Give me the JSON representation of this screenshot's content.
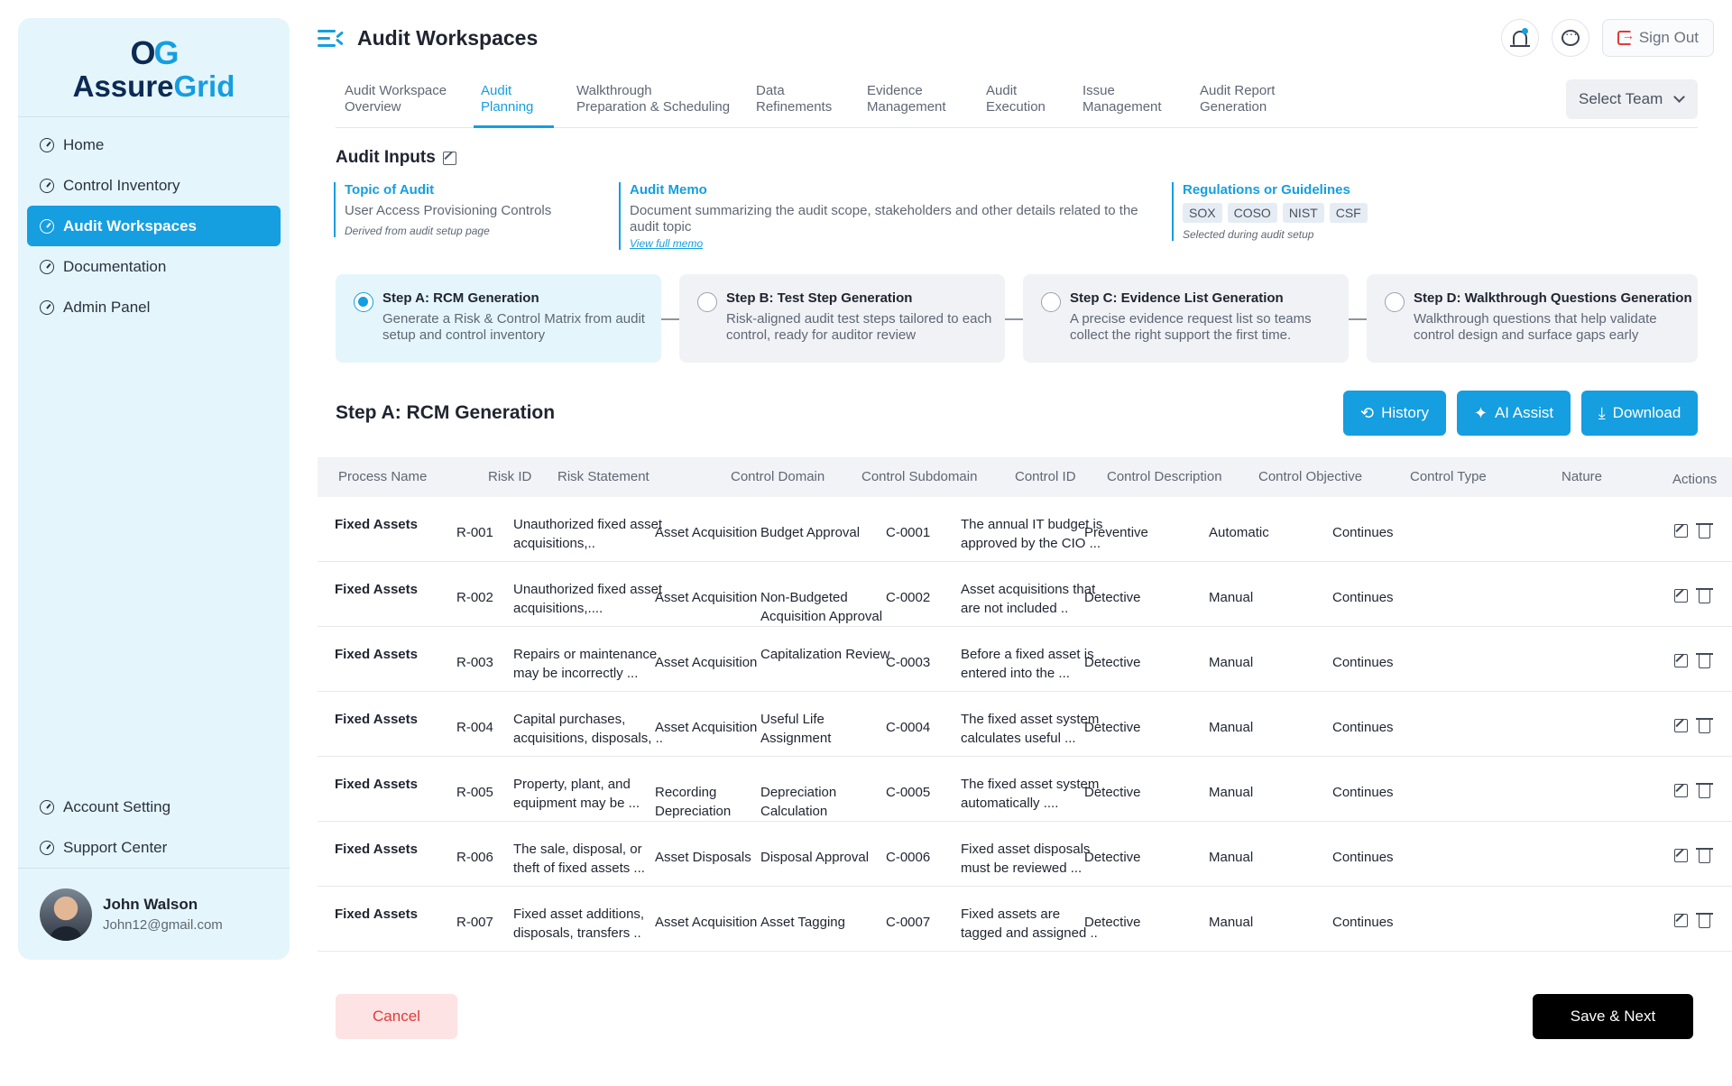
{
  "brand": {
    "logo_mark_left": "O",
    "logo_mark_right": "G",
    "name_part1": "Assure",
    "name_part2": "Grid"
  },
  "sidebar": {
    "items": [
      {
        "label": "Home",
        "icon": "gauge-icon",
        "active": false
      },
      {
        "label": "Control Inventory",
        "icon": "gauge-icon",
        "active": false
      },
      {
        "label": "Audit Workspaces",
        "icon": "gauge-icon",
        "active": true
      },
      {
        "label": "Documentation",
        "icon": "gauge-icon",
        "active": false
      },
      {
        "label": "Admin Panel",
        "icon": "gauge-icon",
        "active": false
      }
    ],
    "bottom_items": [
      {
        "label": "Account Setting",
        "icon": "gauge-icon"
      },
      {
        "label": "Support Center",
        "icon": "gauge-icon"
      }
    ],
    "user": {
      "name": "John Walson",
      "email": "John12@gmail.com"
    }
  },
  "header": {
    "title": "Audit Workspaces",
    "signout_label": "Sign Out"
  },
  "tabs": {
    "items": [
      {
        "label": "Audit Workspace\nOverview",
        "active": false
      },
      {
        "label": "Audit\nPlanning",
        "active": true
      },
      {
        "label": "Walkthrough\nPreparation & Scheduling",
        "active": false
      },
      {
        "label": "Data\nRefinements",
        "active": false
      },
      {
        "label": "Evidence\nManagement",
        "active": false
      },
      {
        "label": "Audit\nExecution",
        "active": false
      },
      {
        "label": "Issue\nManagement",
        "active": false
      },
      {
        "label": "Audit Report\nGeneration",
        "active": false
      }
    ],
    "team_select": "Select Team"
  },
  "audit_inputs": {
    "title": "Audit Inputs",
    "topic": {
      "label": "Topic of Audit",
      "value": "User Access Provisioning Controls",
      "note": "Derived from audit setup page"
    },
    "memo": {
      "label": "Audit Memo",
      "value": "Document summarizing the audit scope, stakeholders and other details related to the audit topic",
      "link": "View full memo"
    },
    "regulations": {
      "label": "Regulations or Guidelines",
      "chips": [
        "SOX",
        "COSO",
        "NIST",
        "CSF"
      ],
      "note": "Selected during audit setup"
    }
  },
  "steps": [
    {
      "title": "Step A: RCM Generation",
      "desc": "Generate a Risk & Control Matrix from audit setup and control inventory",
      "selected": true
    },
    {
      "title": "Step B: Test Step Generation",
      "desc": "Risk-aligned audit test steps tailored to each control, ready for auditor review",
      "selected": false
    },
    {
      "title": "Step C: Evidence List Generation",
      "desc": "A precise evidence request list so teams collect the right support the first time.",
      "selected": false
    },
    {
      "title": "Step D: Walkthrough Questions Generation",
      "desc": "Walkthrough questions that help validate control design and surface gaps early",
      "selected": false
    }
  ],
  "section": {
    "title": "Step A: RCM Generation",
    "history_label": "History",
    "ai_assist_label": "AI Assist",
    "download_label": "Download"
  },
  "table": {
    "headers": [
      "Process Name",
      "Risk ID",
      "Risk Statement",
      "Control Domain",
      "Control Subdomain",
      "Control ID",
      "Control Description",
      "Control Objective",
      "Control Type",
      "Nature",
      "Actions"
    ],
    "rows": [
      {
        "process": "Fixed Assets",
        "risk_id": "R-001",
        "risk_statement": "Unauthorized fixed asset acquisitions,..",
        "domain": "Asset Acquisition",
        "subdomain": "Budget Approval",
        "control_id": "C-0001",
        "description": "The annual IT budget is approved by the CIO ...",
        "objective": "Preventive",
        "type": "Automatic",
        "nature": "Continues"
      },
      {
        "process": "Fixed Assets",
        "risk_id": "R-002",
        "risk_statement": "Unauthorized fixed asset acquisitions,....",
        "domain": "Asset Acquisition",
        "subdomain": "Non-Budgeted Acquisition Approval",
        "control_id": "C-0002",
        "description": "Asset acquisitions that are not included ..",
        "objective": "Detective",
        "type": "Manual",
        "nature": "Continues"
      },
      {
        "process": "Fixed Assets",
        "risk_id": "R-003",
        "risk_statement": "Repairs or maintenance may be incorrectly ...",
        "domain": "Asset Acquisition",
        "subdomain": "Capitalization Review",
        "control_id": "C-0003",
        "description": "Before a fixed asset is entered into the ...",
        "objective": "Detective",
        "type": "Manual",
        "nature": "Continues"
      },
      {
        "process": "Fixed Assets",
        "risk_id": "R-004",
        "risk_statement": "Capital purchases, acquisitions, disposals, ..",
        "domain": "Asset Acquisition",
        "subdomain": "Useful Life Assignment",
        "control_id": "C-0004",
        "description": "The fixed asset system calculates useful ...",
        "objective": "Detective",
        "type": "Manual",
        "nature": "Continues"
      },
      {
        "process": "Fixed Assets",
        "risk_id": "R-005",
        "risk_statement": "Property, plant, and equipment may be ...",
        "domain": "Recording Depreciation",
        "subdomain": "Depreciation Calculation",
        "control_id": "C-0005",
        "description": "The fixed asset system automatically ....",
        "objective": "Detective",
        "type": "Manual",
        "nature": "Continues"
      },
      {
        "process": "Fixed Assets",
        "risk_id": "R-006",
        "risk_statement": "The sale, disposal, or theft of fixed assets ...",
        "domain": "Asset Disposals",
        "subdomain": "Disposal Approval",
        "control_id": "C-0006",
        "description": "Fixed asset disposals must be reviewed ...",
        "objective": "Detective",
        "type": "Manual",
        "nature": "Continues"
      },
      {
        "process": "Fixed Assets",
        "risk_id": "R-007",
        "risk_statement": "Fixed asset additions, disposals, transfers ..",
        "domain": "Asset Acquisition",
        "subdomain": "Asset Tagging",
        "control_id": "C-0007",
        "description": "Fixed assets are tagged and assigned ..",
        "objective": "Detective",
        "type": "Manual",
        "nature": "Continues"
      }
    ]
  },
  "footer": {
    "cancel_label": "Cancel",
    "save_label": "Save & Next"
  },
  "colors": {
    "accent": "#159ee0",
    "navy": "#0b2a54",
    "danger": "#e33a3a"
  }
}
